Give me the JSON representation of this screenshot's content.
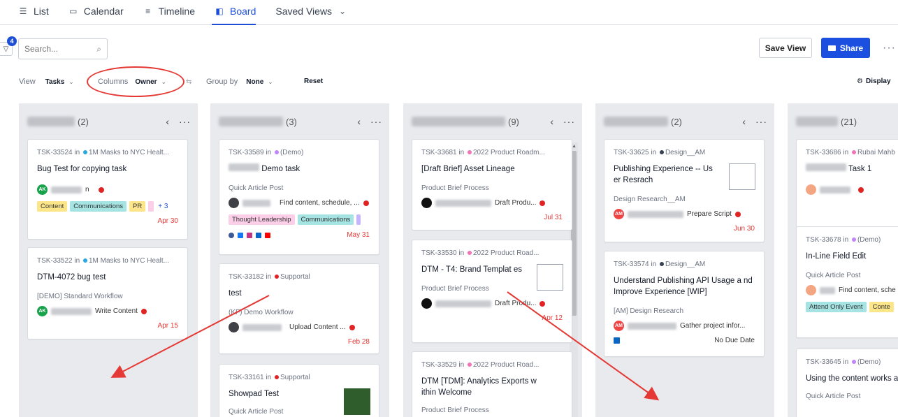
{
  "tabs": [
    {
      "label": "List",
      "icon": "list-icon"
    },
    {
      "label": "Calendar",
      "icon": "calendar-icon"
    },
    {
      "label": "Timeline",
      "icon": "timeline-icon"
    },
    {
      "label": "Board",
      "icon": "board-icon",
      "active": true
    },
    {
      "label": "Saved Views",
      "icon": "chevron-down-icon"
    }
  ],
  "filter": {
    "badge": "4"
  },
  "search": {
    "placeholder": "Search..."
  },
  "toolbar": {
    "save_view": "Save View",
    "share": "Share",
    "more": "···"
  },
  "controls": {
    "view_label": "View",
    "view_value": "Tasks",
    "columns_label": "Columns",
    "columns_value": "Owner",
    "group_label": "Group by",
    "group_value": "None",
    "reset": "Reset",
    "display": "Display"
  },
  "columns": [
    {
      "count": "(2)",
      "cards": [
        {
          "meta_id": "TSK-33524",
          "meta_in": "in",
          "meta_project": "1M Masks to NYC Healt...",
          "title": "Bug Test for copying task",
          "assignee_suffix": "n",
          "tags": [
            "Content",
            "Communications",
            "PR"
          ],
          "more_tags": "+ 3",
          "due": "Apr 30"
        },
        {
          "meta_id": "TSK-33522",
          "meta_in": "in",
          "meta_project": "1M Masks to NYC Healt...",
          "title": "DTM-4072 bug test",
          "process": "[DEMO] Standard Workflow",
          "step": "Write Content",
          "due": "Apr 15"
        }
      ]
    },
    {
      "count": "(3)",
      "cards": [
        {
          "meta_id": "TSK-33589",
          "meta_in": "in",
          "meta_project": "(Demo)",
          "title": "Demo task",
          "process": "Quick Article Post",
          "step": "Find content, schedule, ...",
          "tags": [
            "Thought Leadership",
            "Communications"
          ],
          "due": "May 31"
        },
        {
          "meta_id": "TSK-33182",
          "meta_in": "in",
          "meta_project": "Supportal",
          "title": "test",
          "process": "(KF) Demo Workflow",
          "step": "Upload Content ...",
          "due": "Feb 28"
        },
        {
          "meta_id": "TSK-33161",
          "meta_in": "in",
          "meta_project": "Supportal",
          "title": "Showpad Test",
          "process": "Quick Article Post"
        }
      ]
    },
    {
      "count": "(9)",
      "cards": [
        {
          "meta_id": "TSK-33681",
          "meta_in": "in",
          "meta_project": "2022 Product Roadm...",
          "title": "[Draft Brief] Asset Lineage",
          "process": "Product Brief Process",
          "step": "Draft Produ...",
          "due": "Jul 31"
        },
        {
          "meta_id": "TSK-33530",
          "meta_in": "in",
          "meta_project": "2022 Product Road...",
          "title": "DTM - T4: Brand Templat es",
          "process": "Product Brief Process",
          "step": "Draft Produ...",
          "due": "Apr 12"
        },
        {
          "meta_id": "TSK-33529",
          "meta_in": "in",
          "meta_project": "2022 Product Road...",
          "title": "DTM [TDM]: Analytics Exports w ithin Welcome",
          "process": "Product Brief Process"
        }
      ]
    },
    {
      "count": "(2)",
      "cards": [
        {
          "meta_id": "TSK-33625",
          "meta_in": "in",
          "meta_project": "Design__AM",
          "title": "Publishing Experience -- Us er Resrach",
          "process": "Design Research__AM",
          "step": "Prepare Script",
          "due": "Jun 30"
        },
        {
          "meta_id": "TSK-33574",
          "meta_in": "in",
          "meta_project": "Design__AM",
          "title": "Understand Publishing API Usage a nd Improve Experience [WIP]",
          "process": "[AM] Design Research",
          "step": "Gather project infor...",
          "due": "No Due Date"
        }
      ]
    },
    {
      "count": "(21)",
      "cards": [
        {
          "meta_id": "TSK-33686",
          "meta_in": "in",
          "meta_project": "Rubai Mahb",
          "title": "Task 1"
        },
        {
          "meta_id": "TSK-33678",
          "meta_in": "in",
          "meta_project": "(Demo)",
          "title": "In-Line Field Edit",
          "process": "Quick Article Post",
          "step": "Find content, sche",
          "tags": [
            "Attend Only Event",
            "Conte"
          ]
        },
        {
          "meta_id": "TSK-33645",
          "meta_in": "in",
          "meta_project": "(Demo)",
          "title": "Using the content works ace",
          "process": "Quick Article Post"
        }
      ]
    }
  ],
  "colors": {
    "accent": "#1d4ed8",
    "share": "#1a4fe0",
    "due_red": "#e53935",
    "annotation_red": "#e53935"
  }
}
